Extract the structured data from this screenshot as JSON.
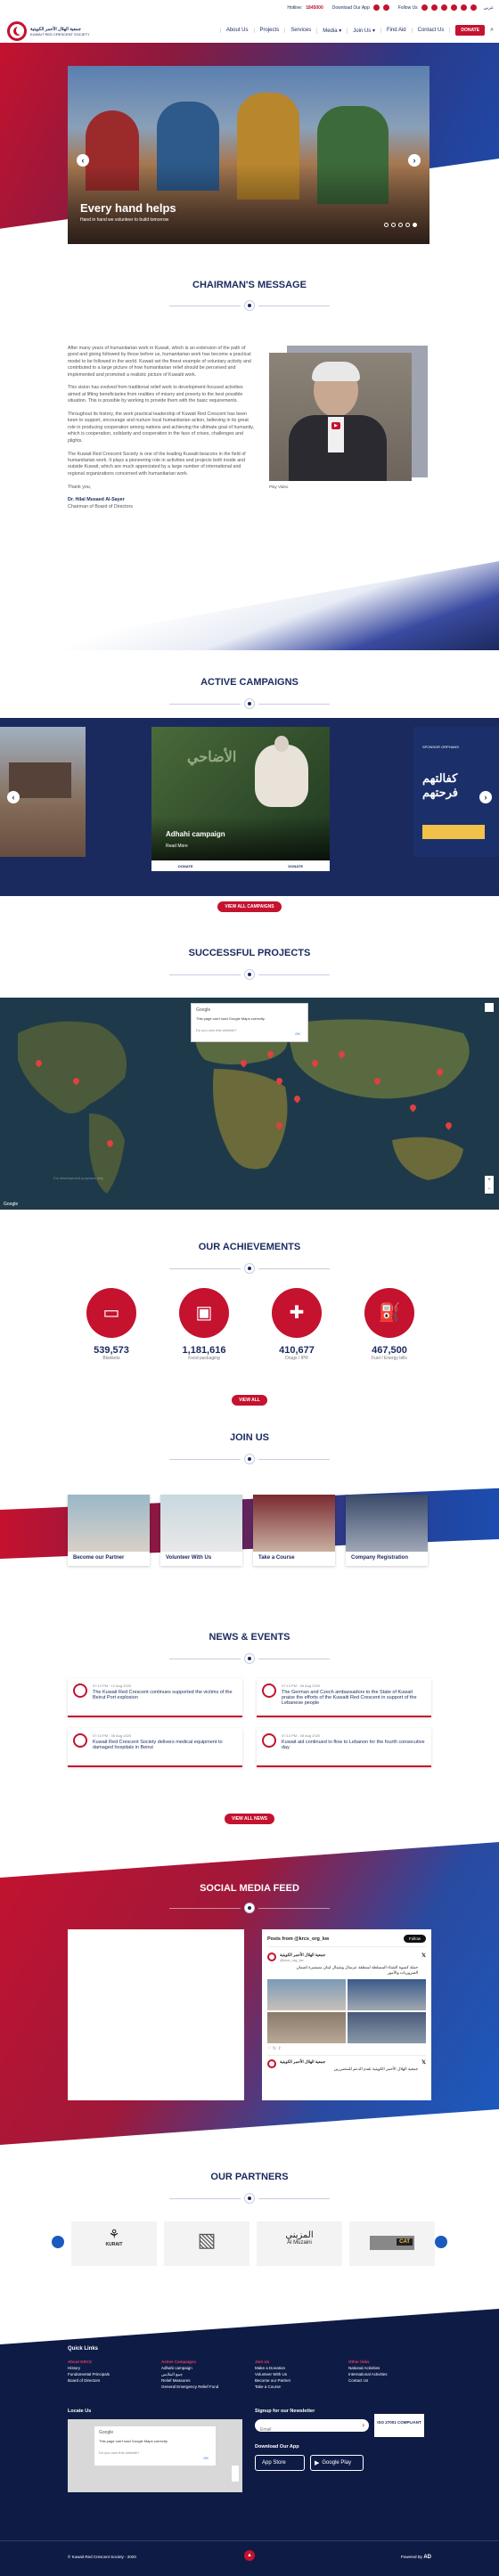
{
  "topbar": {
    "hotline_label": "Hotline:",
    "hotline": "1845000",
    "download_label": "Download Our App",
    "follow_label": "Follow Us",
    "lang": "عربي"
  },
  "logo": {
    "ar": "جمعية الهلال الأحمر الكويتية",
    "en": "KUWAIT RED CRESCENT SOCIETY"
  },
  "nav": [
    "About Us",
    "Projects",
    "Services",
    "Media",
    "Join Us",
    "Find Aid",
    "Contact Us"
  ],
  "donate": "DONATE",
  "hero": {
    "title": "Every hand helps",
    "subtitle": "Hand in hand we volunteer to build tomorrow"
  },
  "chairman": {
    "heading": "CHAIRMAN'S MESSAGE",
    "p1": "After many years of humanitarian work in Kuwait, which is an extension of the path of good and giving followed by those before us, humanitarian work has become a practical model to be followed in the world. Kuwait set the finest example of voluntary activity and contributed to a large picture of how humanitarian relief should be perceived and implemented and promoted a realistic picture of Kuwaiti work.",
    "p2": "This vision has evolved from traditional relief work to development-focused activities aimed at lifting beneficiaries from realities of misery and poverty to the best possible situation. This is possible by working to provide them with the basic requirements.",
    "p3": "Throughout its history, the work practical leadership of Kuwait Red Crescent has been keen to support, encourage and nurture local humanitarian action, believing in its great role in producing cooperation among nations and achieving the ultimate goal of humanity, which is cooperation, solidarity and cooperation in the face of crises, challenges and plights.",
    "p4": "The Kuwait Red Crescent Society is one of the leading Kuwaiti beacons in the field of humanitarian work. It plays a pioneering role in activities and projects both inside and outside Kuwait, which are much appreciated by a large number of international and regional organizations concerned with humanitarian work.",
    "p5": "Thank you,",
    "sign_name": "Dr. Hilal Musaed Al-Sayer",
    "sign_title": "Chairman of Board of Directors",
    "play": "Play Video"
  },
  "campaigns": {
    "heading": "ACTIVE CAMPAIGNS",
    "card_title": "Adhahi campaign",
    "card_link": "Read More",
    "card_ar": "الأضاحي",
    "right_ar": "كفالتهم فرحتهم",
    "right_tag": "SPONSOR ORPHANS",
    "view_all": "VIEW ALL CAMPAIGNS",
    "card_btn": "DONATE"
  },
  "projects": {
    "heading": "SUCCESSFUL PROJECTS",
    "map_popup_title": "Google",
    "map_popup_text": "This page can't load Google Maps correctly.",
    "map_popup_link": "Do you own this website?",
    "map_popup_ok": "OK",
    "google": "Google",
    "watermark": "For development purposes only"
  },
  "achievements": {
    "heading": "OUR ACHIEVEMENTS",
    "items": [
      {
        "value": "539,573",
        "label": "Blankets"
      },
      {
        "value": "1,181,616",
        "label": "Food packaging"
      },
      {
        "value": "410,677",
        "label": "Drugs / IPR"
      },
      {
        "value": "467,500",
        "label": "Fuel / Energy bills"
      }
    ],
    "view_all": "VIEW ALL"
  },
  "join": {
    "heading": "JOIN US",
    "items": [
      "Become our Partner",
      "Volunteer With Us",
      "Take a Course",
      "Company Registration"
    ]
  },
  "news": {
    "heading": "NEWS & EVENTS",
    "items": [
      {
        "date": "07:13 PM - 12 Aug 2020",
        "text": "The Kuwait Red Crescent continues supported the victims of the Beirut Port explosion"
      },
      {
        "date": "07:13 PM - 08 Aug 2020",
        "text": "The German and Czech ambassadors to the State of Kuwait praise the efforts of the Kuwaiti Red Crescent in support of the Lebanese people"
      },
      {
        "date": "07:13 PM - 08 Aug 2020",
        "text": "Kuwait Red Crescent Society delivers medical equipment to damaged hospitals in Beirut"
      },
      {
        "date": "07:13 PM - 08 Aug 2020",
        "text": "Kuwait aid continued to flow to Lebanon for the fourth consecutive day"
      }
    ],
    "view_all": "VIEW ALL NEWS"
  },
  "social": {
    "heading": "SOCIAL MEDIA FEED",
    "feed_title": "Posts from @krcs_org_kw",
    "follow": "Follow",
    "account": "جمعية الهلال الأحمر الكويتية",
    "handle": "@krcs_org_kw",
    "post1": "حملة كسوة الشتاء المسلطة لمنطقة عرسال وشمال لبنان مستمرة لضمان الضروريات والأمور",
    "post2": "جمعية الهلال الأحمر الكويتية تقدم الدعم للمتضررين"
  },
  "partners": {
    "heading": "OUR PARTNERS",
    "items": [
      "KURAIT",
      "",
      "Al Muzaini",
      "CAT"
    ]
  },
  "footer": {
    "quick_links": "Quick Links",
    "col1_title": "About KRCS",
    "col1": [
      "History",
      "Fundamental Principals",
      "Board of Directors"
    ],
    "col2_title": "Active Campaigns",
    "col2": [
      "Adhahi campaign",
      "جمع الملابس",
      "Relief Measures",
      "General Emergency Relief Fund"
    ],
    "col3_title": "Join Us",
    "col3": [
      "Make a Donation",
      "Volunteer With Us",
      "Become our Partner",
      "Take a Course"
    ],
    "col4_title": "Other links",
    "col4": [
      "National Activities",
      "International Activities",
      "Contact Us"
    ],
    "locate": "Locate Us",
    "newsletter": "Signup for our Newsletter",
    "email_placeholder": "Email",
    "subscribe": "›",
    "iso": "ISO 27001 COMPLIANT",
    "app_title": "Download Our App",
    "appstore": "App Store",
    "googleplay": "Google Play",
    "map_popup_title": "Google",
    "map_popup_text": "This page can't load Google Maps correctly.",
    "map_popup_link": "Do you own this website?",
    "map_popup_ok": "OK",
    "copyright": "© Kuwait Red Crescent Society - 2020",
    "powered": "Powered By"
  },
  "colors": {
    "navy": "#1b2a5e",
    "red": "#c4122f",
    "footer": "#0e1b45"
  }
}
